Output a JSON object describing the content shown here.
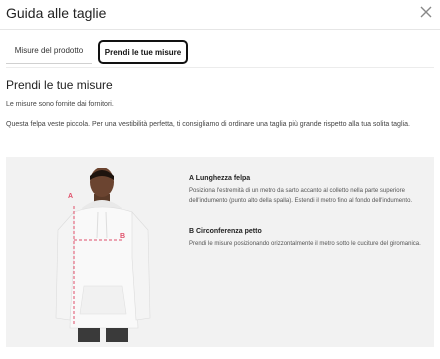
{
  "header": {
    "title": "Guida alle taglie"
  },
  "tabs": [
    {
      "label": "Misure del prodotto",
      "active": false
    },
    {
      "label": "Prendi le tue misure",
      "active": true
    }
  ],
  "main": {
    "section_title": "Prendi le tue misure",
    "intro": "Le misure sono fornite dai fornitori.",
    "advice": "Questa felpa veste piccola. Per una vestibilità perfetta, ti consigliamo di ordinare una taglia più grande rispetto alla tua solita taglia."
  },
  "diagram": {
    "label_a": "A",
    "label_b": "B",
    "line_color": "#e0506a"
  },
  "measurements": [
    {
      "heading": "A Lunghezza felpa",
      "description": "Posiziona l'estremità di un metro da sarto accanto al colletto nella parte superiore dell'indumento (punto alto della spalla). Estendi il metro fino al fondo dell'indumento."
    },
    {
      "heading": "B Circonferenza petto",
      "description": "Prendi le misure posizionando orizzontalmente il metro sotto le cuciture del giromanica."
    }
  ]
}
